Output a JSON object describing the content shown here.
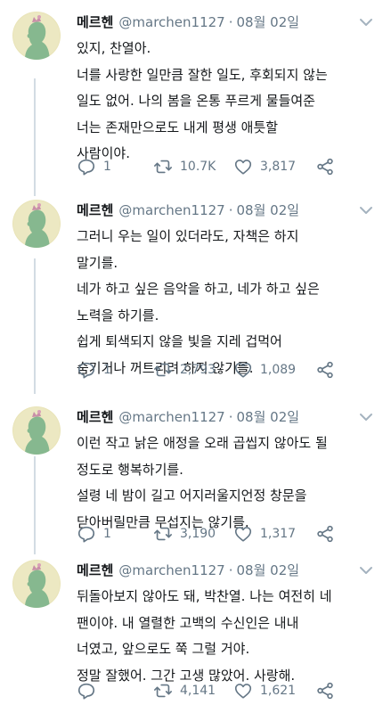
{
  "colors": {
    "accent": "#1da1f2",
    "muted": "#657786",
    "text": "#14171a",
    "thread": "#d3dce3"
  },
  "tweets": [
    {
      "name": "메르헨",
      "handle": "@marchen1127",
      "sep": "·",
      "date": "08월 02일",
      "lines": [
        "있지, 찬열아.",
        "너를 사랑한 일만큼 잘한 일도, 후회되지 않는",
        "일도 없어. 나의 봄을 온통 푸르게 물들여준",
        "너는 존재만으로도 내게 평생 애틋할",
        "사람이야."
      ],
      "reply_count": "1",
      "retweet_count": "10.7K",
      "like_count": "3,817"
    },
    {
      "name": "메르헨",
      "handle": "@marchen1127",
      "sep": "·",
      "date": "08월 02일",
      "lines": [
        "그러니 우는 일이 있더라도, 자책은 하지",
        "말기를.",
        "네가 하고 싶은 음악을 하고, 네가 하고 싶은",
        "노력을 하기를.",
        "쉽게 퇴색되지 않을 빛을 지레 겁먹어",
        "숨기거나 꺼트리려 하지 않기를."
      ],
      "reply_count": "1",
      "retweet_count": "2,793",
      "like_count": "1,089"
    },
    {
      "name": "메르헨",
      "handle": "@marchen1127",
      "sep": "·",
      "date": "08월 02일",
      "lines": [
        "이런 작고 낡은 애정을 오래 곱씹지 않아도 될",
        "정도로 행복하기를.",
        "설령 네 밤이 길고 어지러울지언정 창문을",
        "닫아버릴만큼 무섭지는 않기를."
      ],
      "reply_count": "1",
      "retweet_count": "3,190",
      "like_count": "1,317"
    },
    {
      "name": "메르헨",
      "handle": "@marchen1127",
      "sep": "·",
      "date": "08월 02일",
      "lines": [
        "뒤돌아보지 않아도 돼, 박찬열. 나는 여전히 네",
        "팬이야. 내 열렬한 고백의 수신인은 내내",
        "너였고, 앞으로도 쭉 그럴 거야.",
        "정말 잘했어. 그간 고생 많았어. 사랑해."
      ],
      "reply_count": "",
      "retweet_count": "4,141",
      "like_count": "1,621"
    }
  ],
  "icons": {
    "avatar": "silhouette-avatar-icon",
    "caret": "chevron-down-icon",
    "reply": "reply-icon",
    "retweet": "retweet-icon",
    "like": "heart-icon",
    "share": "share-icon"
  }
}
